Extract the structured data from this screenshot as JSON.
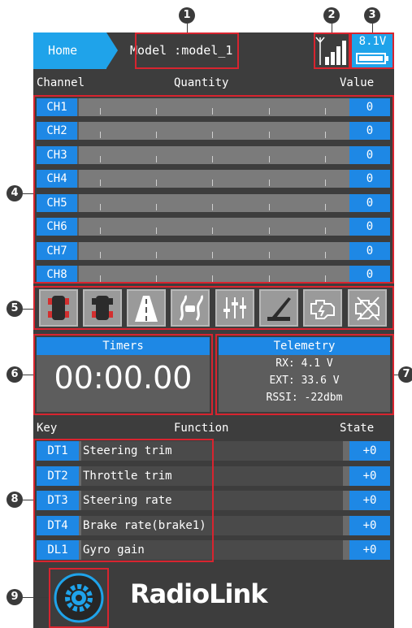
{
  "header": {
    "home_label": "Home",
    "model_label": "Model :model_1",
    "voltage": "8.1V",
    "signal_icon": "signal-bars-icon",
    "battery_icon": "battery-icon"
  },
  "channels": {
    "header_channel": "Channel",
    "header_quantity": "Quantity",
    "header_value": "Value",
    "items": [
      {
        "label": "CH1",
        "value": "0"
      },
      {
        "label": "CH2",
        "value": "0"
      },
      {
        "label": "CH3",
        "value": "0"
      },
      {
        "label": "CH4",
        "value": "0"
      },
      {
        "label": "CH5",
        "value": "0"
      },
      {
        "label": "CH6",
        "value": "0"
      },
      {
        "label": "CH7",
        "value": "0"
      },
      {
        "label": "CH8",
        "value": "0"
      }
    ]
  },
  "mode_icons": [
    "car-top-icon",
    "car-top-red-icon",
    "road-icon",
    "skid-road-icon",
    "mixer-sliders-icon",
    "brake-lever-icon",
    "engine-icon",
    "engine-cut-icon"
  ],
  "timers": {
    "title": "Timers",
    "value": "00:00.00"
  },
  "telemetry": {
    "title": "Telemetry",
    "rx": "RX:  4.1 V",
    "ext": "EXT:  33.6 V",
    "rssi": "RSSI: -22dbm"
  },
  "keys": {
    "header_key": "Key",
    "header_function": "Function",
    "header_state": "State",
    "items": [
      {
        "key": "DT1",
        "function": "Steering trim",
        "state": "+0"
      },
      {
        "key": "DT2",
        "function": "Throttle trim",
        "state": "+0"
      },
      {
        "key": "DT3",
        "function": "Steering rate",
        "state": "+0"
      },
      {
        "key": "DT4",
        "function": "Brake rate(brake1)",
        "state": "+0"
      },
      {
        "key": "DL1",
        "function": "Gyro gain",
        "state": "+0"
      }
    ]
  },
  "markers": [
    "1",
    "2",
    "3",
    "4",
    "5",
    "6",
    "7",
    "8",
    "9"
  ],
  "logo": "RadioLink",
  "settings_icon": "settings-gear-icon",
  "colors": {
    "accent": "#1e88e5",
    "highlight": "#d8242f",
    "background": "#3d3d3d"
  }
}
